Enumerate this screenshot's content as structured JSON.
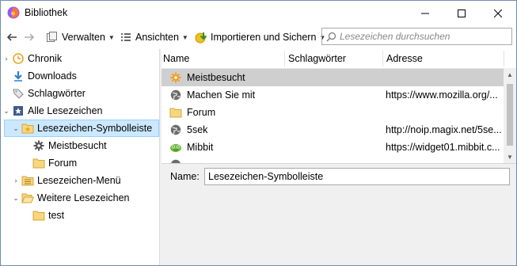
{
  "window": {
    "title": "Bibliothek"
  },
  "toolbar": {
    "manage": "Verwalten",
    "views": "Ansichten",
    "import_backup": "Importieren und Sichern",
    "search_placeholder": "Lesezeichen durchsuchen"
  },
  "tree": {
    "items": [
      {
        "label": "Chronik"
      },
      {
        "label": "Downloads"
      },
      {
        "label": "Schlagwörter"
      },
      {
        "label": "Alle Lesezeichen"
      },
      {
        "label": "Lesezeichen-Symbolleiste"
      },
      {
        "label": "Meistbesucht"
      },
      {
        "label": "Forum"
      },
      {
        "label": "Lesezeichen-Menü"
      },
      {
        "label": "Weitere Lesezeichen"
      },
      {
        "label": "test"
      }
    ]
  },
  "list": {
    "columns": {
      "name": "Name",
      "tags": "Schlagwörter",
      "address": "Adresse"
    },
    "rows": [
      {
        "name": "Meistbesucht",
        "address": ""
      },
      {
        "name": "Machen Sie mit",
        "address": "https://www.mozilla.org/..."
      },
      {
        "name": "Forum",
        "address": ""
      },
      {
        "name": "5sek",
        "address": "http://noip.magix.net/5se..."
      },
      {
        "name": "Mibbit",
        "address": "https://widget01.mibbit.c..."
      }
    ]
  },
  "details": {
    "name_label": "Name:",
    "name_value": "Lesezeichen-Symbolleiste"
  },
  "colors": {
    "selection": "#cce8ff",
    "selection_border": "#99d1ff",
    "list_selection": "#cfcfcf"
  }
}
